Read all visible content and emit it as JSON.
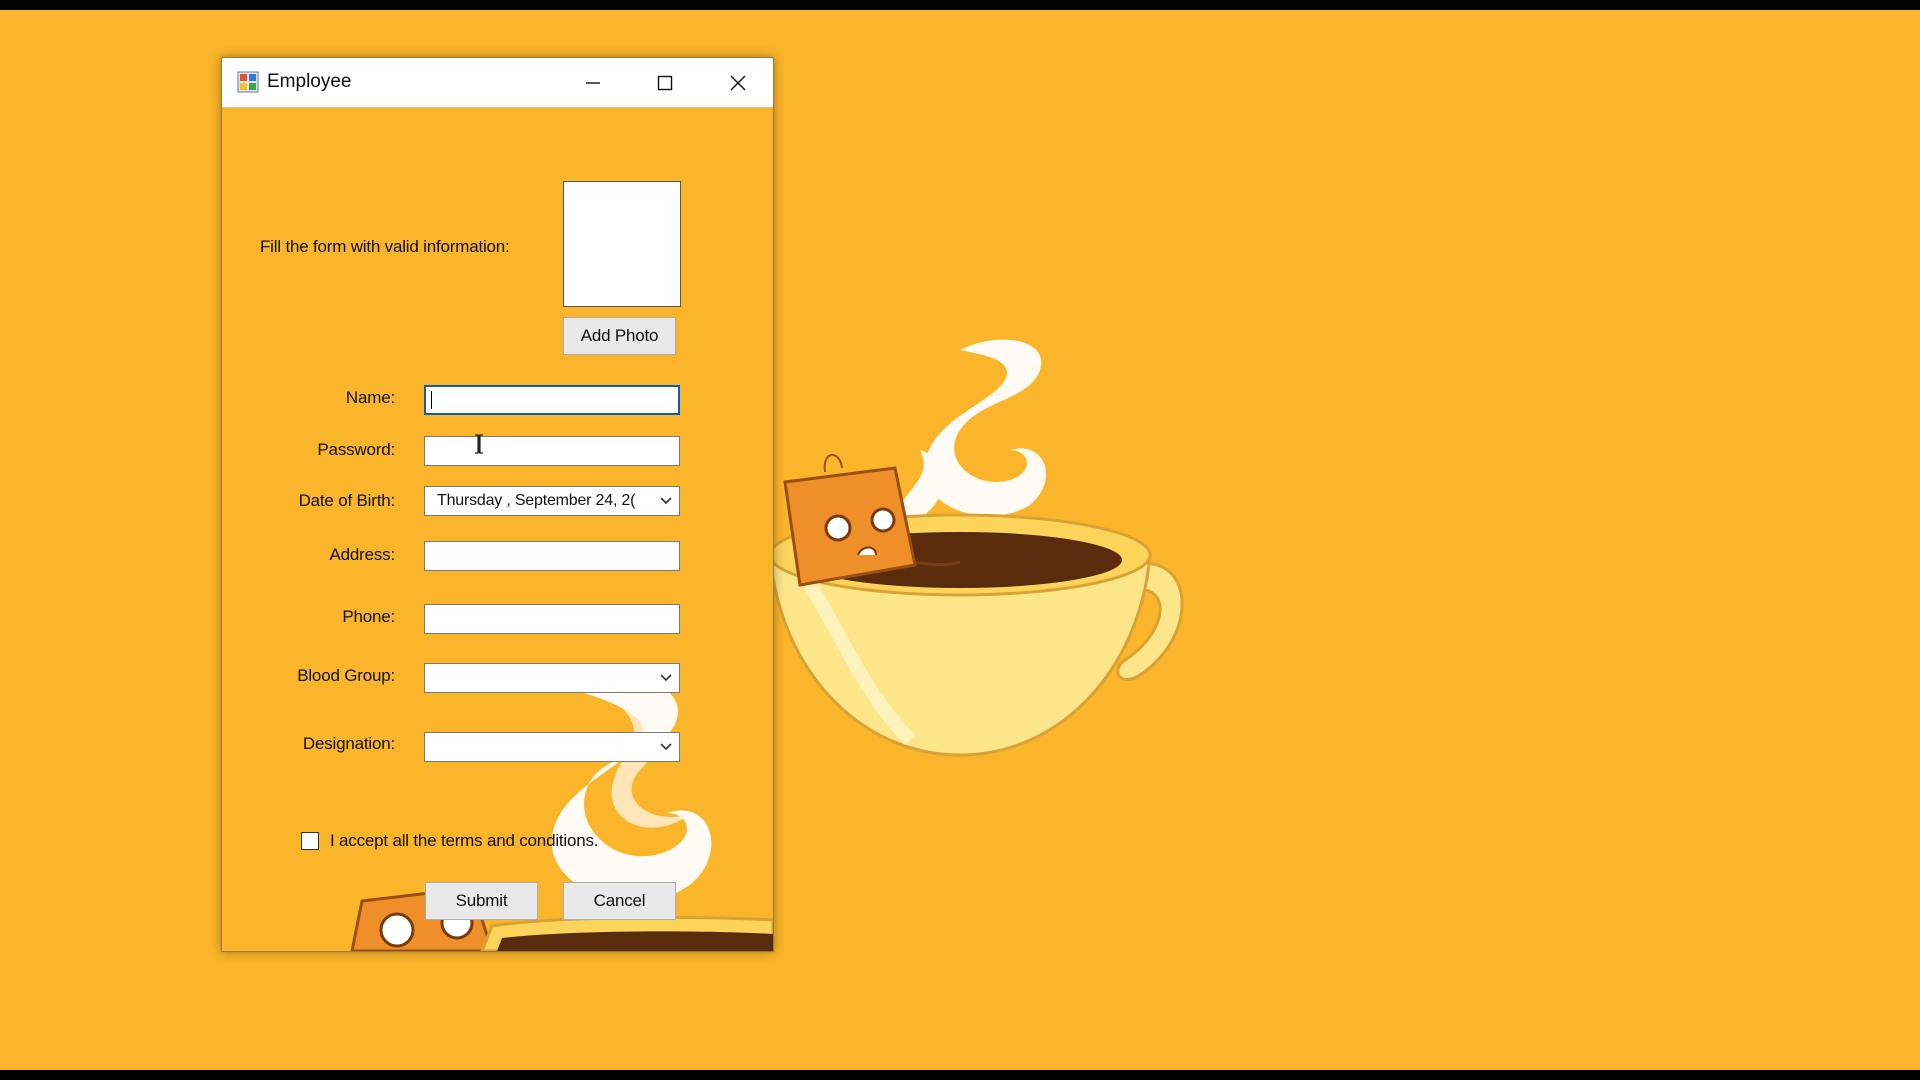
{
  "window": {
    "title": "Employee",
    "controls": {
      "minimize": "minimize-icon",
      "maximize": "maximize-icon",
      "close": "close-icon"
    }
  },
  "form": {
    "instruction": "Fill the form with valid information:",
    "add_photo_label": "Add Photo",
    "fields": {
      "name": {
        "label": "Name:",
        "value": ""
      },
      "password": {
        "label": "Password:",
        "value": ""
      },
      "dob": {
        "label": "Date of Birth:",
        "value": "Thursday   , September 24, 2("
      },
      "address": {
        "label": "Address:",
        "value": ""
      },
      "phone": {
        "label": "Phone:",
        "value": ""
      },
      "blood_group": {
        "label": "Blood Group:",
        "value": ""
      },
      "designation": {
        "label": "Designation:",
        "value": ""
      }
    },
    "terms_label": "I accept all the terms and conditions.",
    "terms_checked": false,
    "submit_label": "Submit",
    "cancel_label": "Cancel"
  },
  "colors": {
    "background": "#fbb52a",
    "focus_border": "#0b5fb3",
    "bag": "#ee8f29",
    "coffee": "#5a2b0c",
    "cup": "#fde58a"
  }
}
